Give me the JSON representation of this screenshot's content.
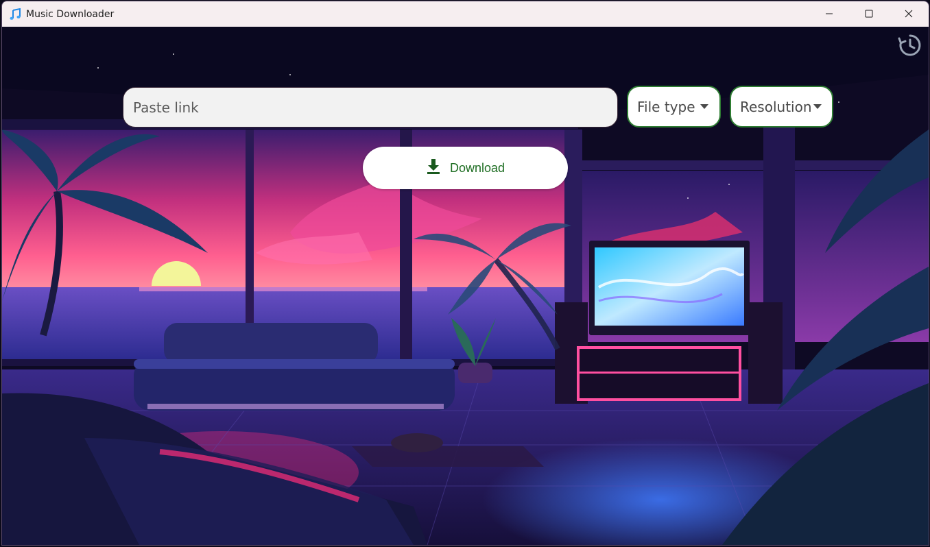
{
  "window": {
    "title": "Music Downloader",
    "app_icon": "music-note-icon",
    "controls": [
      "minimize-icon",
      "maximize-icon",
      "close-icon"
    ]
  },
  "toolbar": {
    "history_icon": "history-icon"
  },
  "form": {
    "link_input": {
      "placeholder": "Paste link",
      "value": ""
    },
    "file_type": {
      "label": "File type",
      "icon": "caret-down-icon"
    },
    "resolution": {
      "label": "Resolution",
      "icon": "caret-down-icon"
    },
    "download_button": {
      "label": "Download",
      "icon": "download-icon"
    }
  },
  "colors": {
    "accent": "#2e7d32",
    "download_text": "#1f6e23",
    "titlebar": "#f6eef0"
  }
}
